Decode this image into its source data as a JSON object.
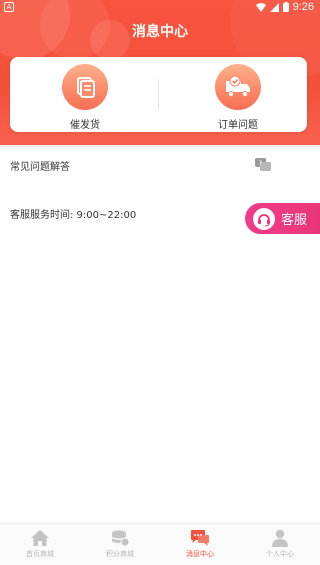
{
  "status_bar": {
    "time": "9:26"
  },
  "header": {
    "title": "消息中心"
  },
  "actions": [
    {
      "label": "催发货",
      "icon": "document-icon"
    },
    {
      "label": "订单问题",
      "icon": "delivery-truck-icon"
    }
  ],
  "faq": {
    "label": "常见问题解答",
    "icon": "chat-question-icon"
  },
  "service_hours": {
    "text": "客服服务时间: 9:00~22:00"
  },
  "service_button": {
    "label": "客服",
    "icon": "headset-icon"
  },
  "bottom_nav": {
    "active_index": 2,
    "active_color": "#f0533d",
    "items": [
      {
        "label": "首页商城",
        "icon": "home-icon"
      },
      {
        "label": "积分商城",
        "icon": "coins-icon"
      },
      {
        "label": "消息中心",
        "icon": "message-icon"
      },
      {
        "label": "个人中心",
        "icon": "user-icon"
      }
    ]
  },
  "colors": {
    "header": "#f4503a",
    "accent_pink": "#e93678"
  }
}
